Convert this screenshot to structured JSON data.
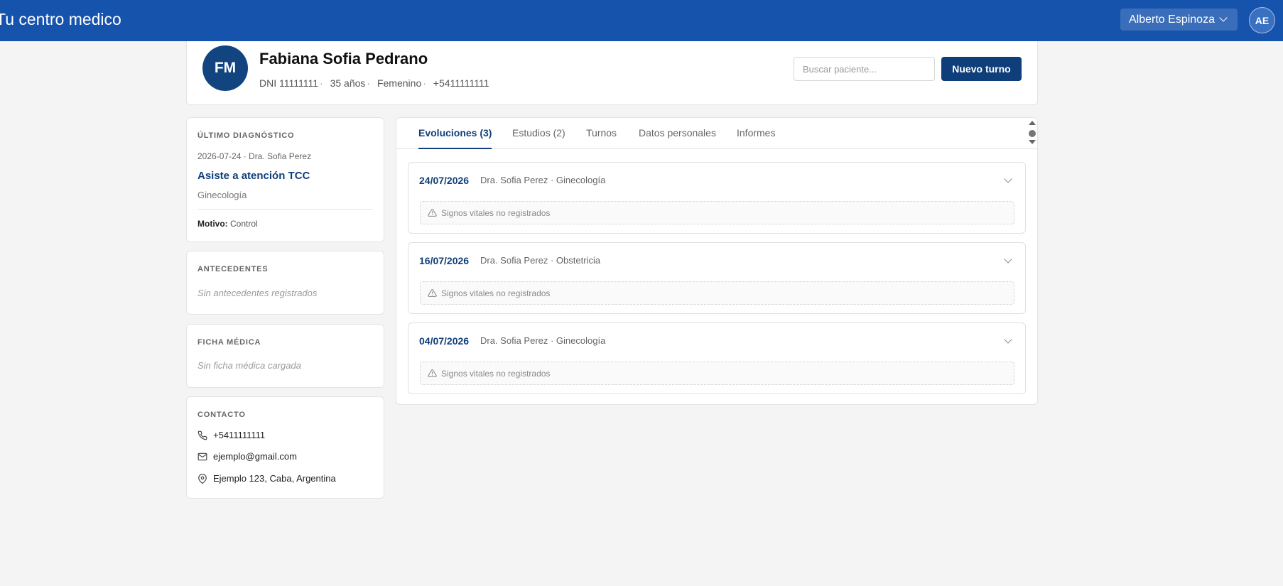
{
  "header": {
    "brand": "Tu centro medico",
    "user_name": "Alberto Espinoza",
    "user_initials": "AE"
  },
  "patient": {
    "initials": "FM",
    "name": "Fabiana Sofia Pedrano",
    "dni": "DNI 11111111",
    "age": "35 años",
    "sex": "Femenino",
    "phone": "+5411111111",
    "search_placeholder": "Buscar paciente...",
    "new_button": "Nuevo turno"
  },
  "diagnosis": {
    "title": "ÚLTIMO DIAGNÓSTICO",
    "meta": "2026-07-24 · Dra. Sofia Perez",
    "name": "Asiste a atención TCC",
    "specialty": "Ginecología",
    "motivo_label": "Motivo:",
    "motivo_value": "Control"
  },
  "antecedentes": {
    "title": "ANTECEDENTES",
    "empty": "Sin antecedentes registrados"
  },
  "ficha": {
    "title": "FICHA MÉDICA",
    "empty": "Sin ficha médica cargada"
  },
  "contacto": {
    "title": "CONTACTO",
    "phone": "+5411111111",
    "email": "ejemplo@gmail.com",
    "address": "Ejemplo 123, Caba, Argentina"
  },
  "tabs": [
    {
      "label": "Evoluciones (3)",
      "active": true
    },
    {
      "label": "Estudios (2)",
      "active": false
    },
    {
      "label": "Turnos",
      "active": false
    },
    {
      "label": "Datos personales",
      "active": false
    },
    {
      "label": "Informes",
      "active": false
    }
  ],
  "evoluciones": [
    {
      "date": "24/07/2026",
      "doctor": "Dra. Sofia Perez · Ginecología",
      "vitals": "Signos vitales no registrados"
    },
    {
      "date": "16/07/2026",
      "doctor": "Dra. Sofia Perez · Obstetricia",
      "vitals": "Signos vitales no registrados"
    },
    {
      "date": "04/07/2026",
      "doctor": "Dra. Sofia Perez · Ginecología",
      "vitals": "Signos vitales no registrados"
    }
  ],
  "colors": {
    "topbar": "#1553ad",
    "primary": "#0f3f7a",
    "avatar": "#12457f",
    "background": "#f4f4f4"
  },
  "icons": [
    "chevron-down-icon",
    "phone-icon",
    "mail-icon",
    "map-pin-icon",
    "warning-icon"
  ]
}
